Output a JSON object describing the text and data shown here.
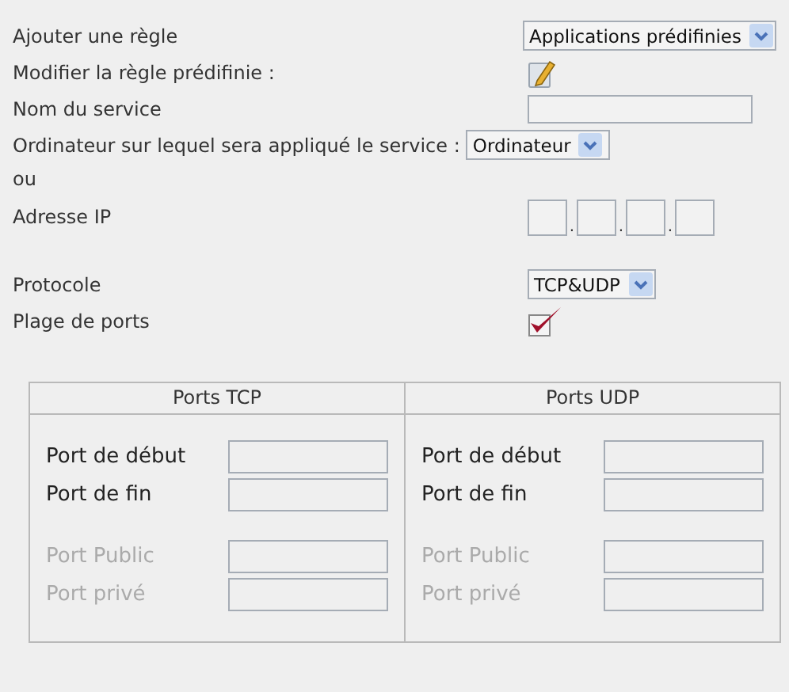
{
  "rule": {
    "label": "Ajouter une règle",
    "value": "Applications prédifinies"
  },
  "edit": {
    "label": "Modifier la règle prédifinie :"
  },
  "service_name": {
    "label": "Nom du service"
  },
  "computer": {
    "label": "Ordinateur sur lequel sera appliqué le service :",
    "value": "Ordinateur"
  },
  "or_label": "ou",
  "ip": {
    "label": "Adresse IP",
    "separators": [
      ".",
      ".",
      "."
    ]
  },
  "protocol": {
    "label": "Protocole",
    "value": "TCP&UDP"
  },
  "port_range": {
    "label": "Plage de ports",
    "checked": true
  },
  "port_tables": [
    {
      "title": "Ports TCP",
      "groups": [
        [
          {
            "label": "Port de début",
            "disabled": false
          },
          {
            "label": "Port de fin",
            "disabled": false
          }
        ],
        [
          {
            "label": "Port Public",
            "disabled": true
          },
          {
            "label": "Port privé",
            "disabled": true
          }
        ]
      ]
    },
    {
      "title": "Ports UDP",
      "groups": [
        [
          {
            "label": "Port de début",
            "disabled": false
          },
          {
            "label": "Port de fin",
            "disabled": false
          }
        ],
        [
          {
            "label": "Port Public",
            "disabled": true
          },
          {
            "label": "Port privé",
            "disabled": true
          }
        ]
      ]
    }
  ]
}
